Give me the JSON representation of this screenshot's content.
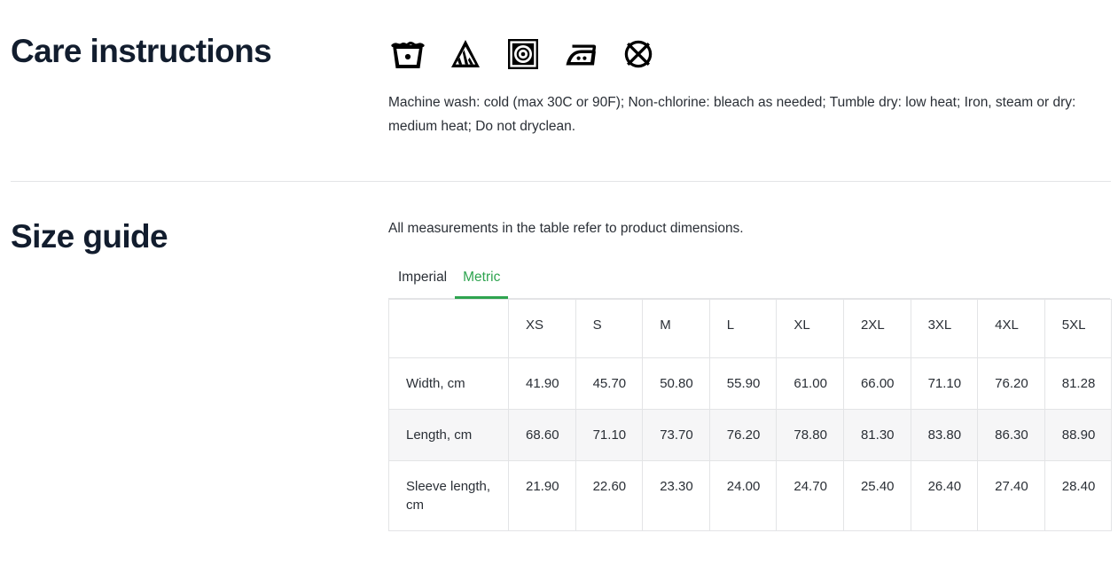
{
  "care": {
    "title": "Care instructions",
    "icons": [
      {
        "name": "machine-wash-cold-icon",
        "label": "Machine wash cold"
      },
      {
        "name": "non-chlorine-bleach-icon",
        "label": "Non-chlorine bleach as needed"
      },
      {
        "name": "tumble-dry-low-icon",
        "label": "Tumble dry low heat"
      },
      {
        "name": "iron-medium-heat-icon",
        "label": "Iron medium heat"
      },
      {
        "name": "do-not-dryclean-icon",
        "label": "Do not dryclean"
      }
    ],
    "description": "Machine wash: cold (max 30C or 90F); Non-chlorine: bleach as needed; Tumble dry: low heat; Iron, steam or dry: medium heat; Do not dryclean."
  },
  "size_guide": {
    "title": "Size guide",
    "note": "All measurements in the table refer to product dimensions.",
    "tabs": [
      {
        "label": "Imperial",
        "active": false
      },
      {
        "label": "Metric",
        "active": true
      }
    ],
    "table": {
      "corner_header": "",
      "columns": [
        "XS",
        "S",
        "M",
        "L",
        "XL",
        "2XL",
        "3XL",
        "4XL",
        "5XL"
      ],
      "rows": [
        {
          "label": "Width, cm",
          "values": [
            "41.90",
            "45.70",
            "50.80",
            "55.90",
            "61.00",
            "66.00",
            "71.10",
            "76.20",
            "81.28"
          ]
        },
        {
          "label": "Length, cm",
          "values": [
            "68.60",
            "71.10",
            "73.70",
            "76.20",
            "78.80",
            "81.30",
            "83.80",
            "86.30",
            "88.90"
          ]
        },
        {
          "label": "Sleeve length, cm",
          "values": [
            "21.90",
            "22.60",
            "23.30",
            "24.00",
            "24.70",
            "25.40",
            "26.40",
            "27.40",
            "28.40"
          ]
        }
      ]
    }
  },
  "colors": {
    "heading": "#121d2e",
    "text": "#2a2f36",
    "accent_green": "#2ea44f",
    "border": "#e3e4e6",
    "row_alt_bg": "#f6f6f7"
  }
}
